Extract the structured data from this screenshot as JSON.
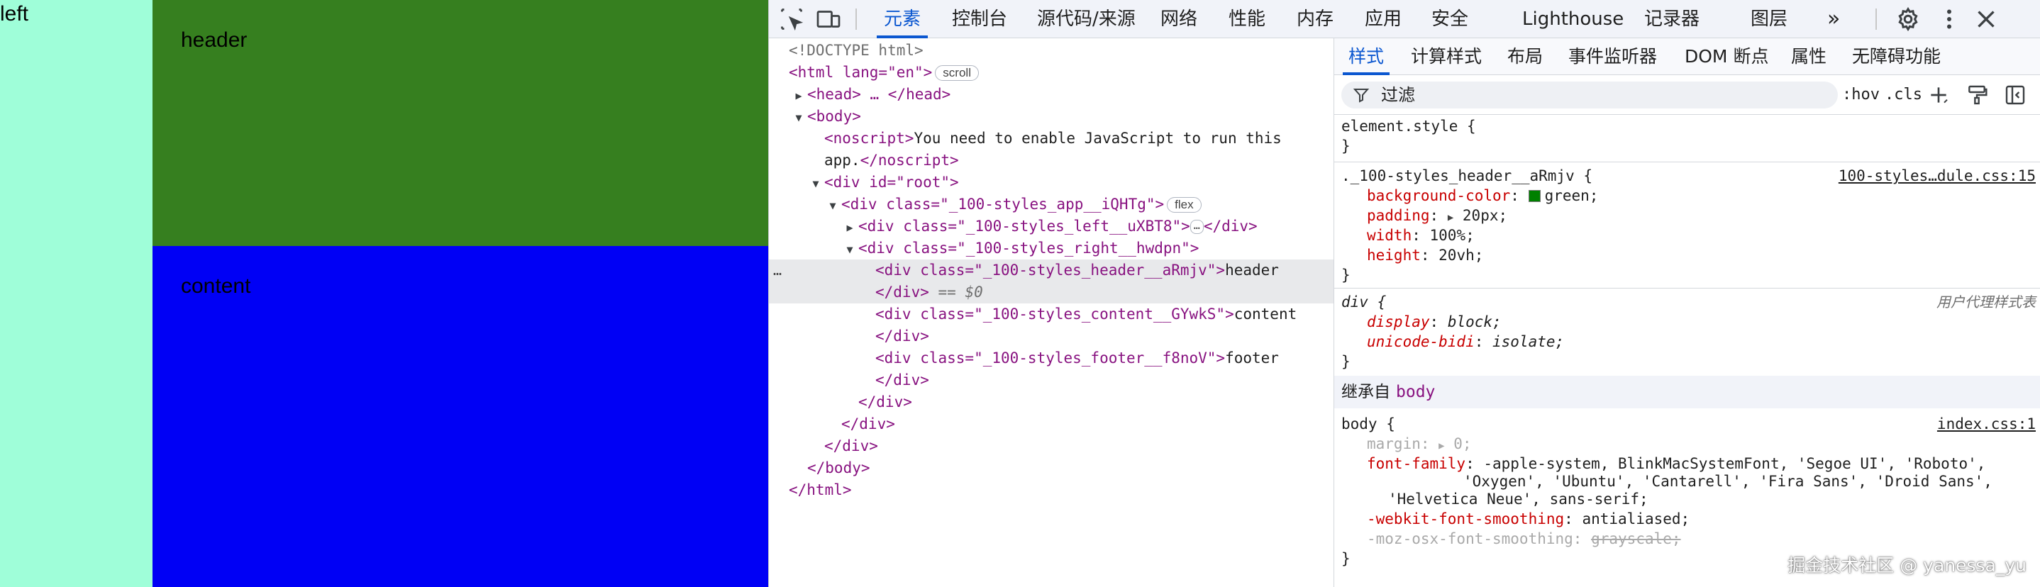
{
  "page": {
    "left_text": "left",
    "header_text": "header",
    "content_text": "content"
  },
  "colors": {
    "left_bg": "#9ffed9",
    "header_bg": "#367f1f",
    "content_bg": "#0000f5",
    "accent": "#0b57d0"
  },
  "toolbar": {
    "icons": [
      "inspect-element-icon",
      "device-toolbar-icon"
    ],
    "tabs": [
      "元素",
      "控制台",
      "源代码/来源",
      "网络",
      "性能",
      "内存",
      "应用",
      "安全",
      "Lighthouse",
      "记录器",
      "图层"
    ],
    "active_tab": "元素",
    "more_tabs": "»",
    "right_icons": [
      "settings-gear-icon",
      "more-vert-icon",
      "close-icon"
    ]
  },
  "elements": {
    "doctype": "<!DOCTYPE html>",
    "html_open": "<html lang=\"en\">",
    "scroll_badge": "scroll",
    "head_line": "<head> … </head>",
    "body_open": "<body>",
    "noscript_open": "<noscript>",
    "noscript_text_1": "You need to enable JavaScript to run this",
    "noscript_text_2": "app.",
    "noscript_close": "</noscript>",
    "root_div": "<div id=\"root\">",
    "app_div": "<div class=\"_100-styles_app__iQHTg\">",
    "flex_badge": "flex",
    "left_div": "<div class=\"_100-styles_left__uXBT8\">",
    "left_close": "</div>",
    "right_div": "<div class=\"_100-styles_right__hwdpn\">",
    "header_div": "<div class=\"_100-styles_header__aRmjv\">",
    "header_text": "header",
    "header_close": "</div>",
    "selected_marker": "== $0",
    "content_div": "<div class=\"_100-styles_content__GYwkS\">",
    "content_text": "content",
    "content_close": "</div>",
    "footer_div": "<div class=\"_100-styles_footer__f8noV\">",
    "footer_text": "footer",
    "footer_close": "</div>",
    "close_right": "</div>",
    "close_app": "</div>",
    "close_root": "</div>",
    "close_body": "</body>",
    "close_html": "</html>",
    "gutter_dots": "…"
  },
  "styles": {
    "tabs": [
      "样式",
      "计算样式",
      "布局",
      "事件监听器",
      "DOM 断点",
      "属性",
      "无障碍功能"
    ],
    "active_tab": "样式",
    "filter_placeholder": "过滤",
    "hov": ":hov",
    "cls": ".cls",
    "element_style": "element.style {",
    "close_brace": "}",
    "rule1": {
      "selector": "._100-styles_header__aRmjv {",
      "source": "100-styles…dule.css:15",
      "props": [
        {
          "name": "background-color",
          "value": "green;"
        },
        {
          "name": "padding",
          "value": "20px;"
        },
        {
          "name": "width",
          "value": "100%;"
        },
        {
          "name": "height",
          "value": "20vh;"
        }
      ]
    },
    "rule2": {
      "selector": "div {",
      "source": "用户代理样式表",
      "props": [
        {
          "name": "display",
          "value": "block;"
        },
        {
          "name": "unicode-bidi",
          "value": "isolate;"
        }
      ]
    },
    "inherited_label": "继承自",
    "inherited_from": "body",
    "rule3": {
      "selector": "body {",
      "source": "index.css:1",
      "margin_name": "margin",
      "margin_value": "0;",
      "font_family_name": "font-family",
      "font_family_1": "-apple-system, BlinkMacSystemFont, 'Segoe UI', 'Roboto',",
      "font_family_2": "'Oxygen', 'Ubuntu', 'Cantarell', 'Fira Sans', 'Droid Sans',",
      "font_family_3": "'Helvetica Neue', sans-serif;",
      "smoothing_name": "-webkit-font-smoothing",
      "smoothing_value": "antialiased;",
      "moz_name": "-moz-osx-font-smoothing",
      "moz_value": "grayscale;"
    }
  },
  "watermark": "掘金技术社区 @ yanessa_yu"
}
